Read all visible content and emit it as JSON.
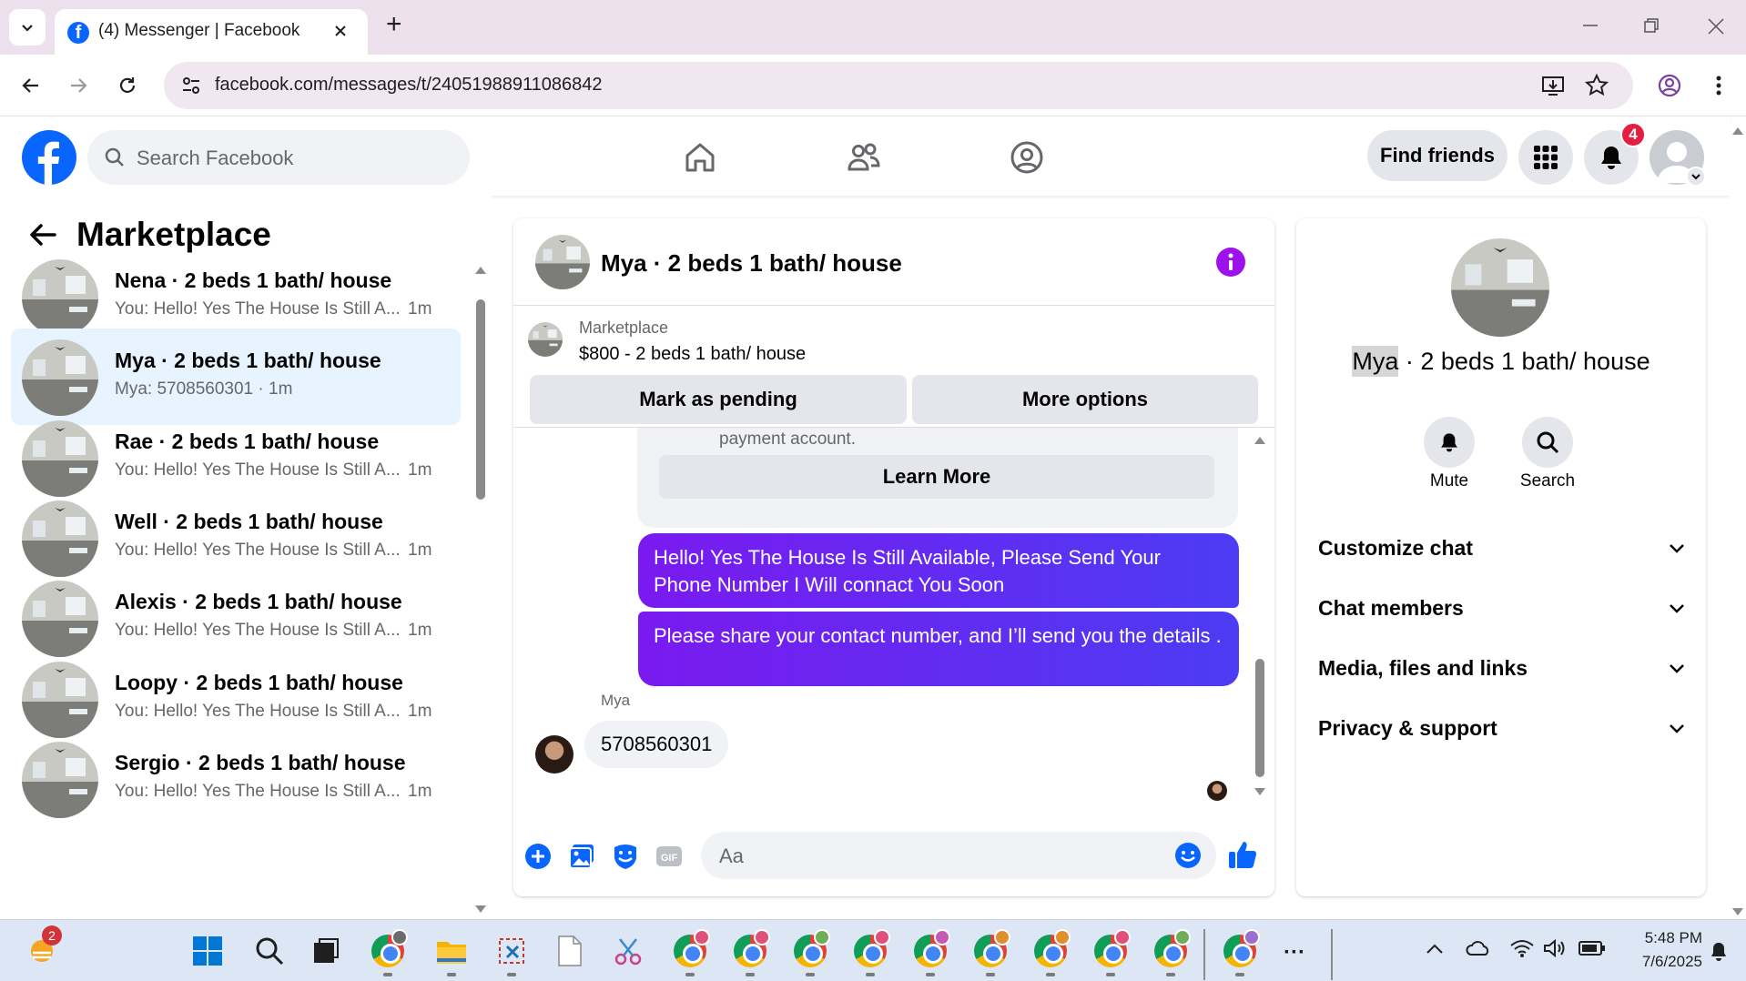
{
  "browser": {
    "tab_title": "(4) Messenger | Facebook",
    "new_tab_label": "+",
    "url": "facebook.com/messages/t/24051988911086842"
  },
  "fb_header": {
    "search_placeholder": "Search Facebook",
    "find_friends_label": "Find friends",
    "notification_count": "4"
  },
  "left_panel": {
    "title": "Marketplace",
    "conversations": [
      {
        "name": "Nena · 2 beds 1 bath/ house",
        "preview": "You: Hello! Yes The House Is Still A...",
        "time": "1m",
        "selected": false
      },
      {
        "name": "Mya · 2 beds 1 bath/ house",
        "preview": "Mya: 5708560301 · 1m",
        "time": "",
        "selected": true
      },
      {
        "name": "Rae · 2 beds 1 bath/ house",
        "preview": "You: Hello! Yes The House Is Still A...",
        "time": "1m",
        "selected": false
      },
      {
        "name": "Well · 2 beds 1 bath/ house",
        "preview": "You: Hello! Yes The House Is Still A...",
        "time": "1m",
        "selected": false
      },
      {
        "name": "Alexis · 2 beds 1 bath/ house",
        "preview": "You: Hello! Yes The House Is Still A...",
        "time": "1m",
        "selected": false
      },
      {
        "name": "Loopy · 2 beds 1 bath/ house",
        "preview": "You: Hello! Yes The House Is Still A...",
        "time": "1m",
        "selected": false
      },
      {
        "name": "Sergio · 2 beds 1 bath/ house",
        "preview": "You: Hello! Yes The House Is Still A...",
        "time": "1m",
        "selected": false
      }
    ]
  },
  "chat": {
    "title": "Mya · 2 beds 1 bath/ house",
    "listing_label": "Marketplace",
    "listing_price": "$800 - 2 beds 1 bath/ house",
    "mark_pending_label": "Mark as pending",
    "more_options_label": "More options",
    "system_text": "payment account.",
    "learn_more_label": "Learn More",
    "messages": [
      {
        "from": "me",
        "text": "Hello! Yes The House  Is Still Available, Please Send Your Phone Number I Will connact You Soon"
      },
      {
        "from": "me",
        "text": "Please share your contact number, and I’ll send you the details ."
      },
      {
        "from": "Mya",
        "sender_label": "Mya",
        "text": "5708560301"
      }
    ],
    "composer_placeholder": "Aa"
  },
  "right_panel": {
    "name_highlight": "Mya",
    "name_rest": " · 2 beds 1 bath/ house",
    "mute_label": "Mute",
    "search_label": "Search",
    "sections": [
      "Customize chat",
      "Chat members",
      "Media, files and links",
      "Privacy & support"
    ]
  },
  "taskbar": {
    "weather_badge": "2",
    "time": "5:48 PM",
    "date": "7/6/2025",
    "more_label": "···"
  },
  "colors": {
    "fb_blue": "#0866ff",
    "messenger_purple": "#7a1af0",
    "notification_red": "#e41e3f",
    "selected_row": "#e7f3ff"
  }
}
